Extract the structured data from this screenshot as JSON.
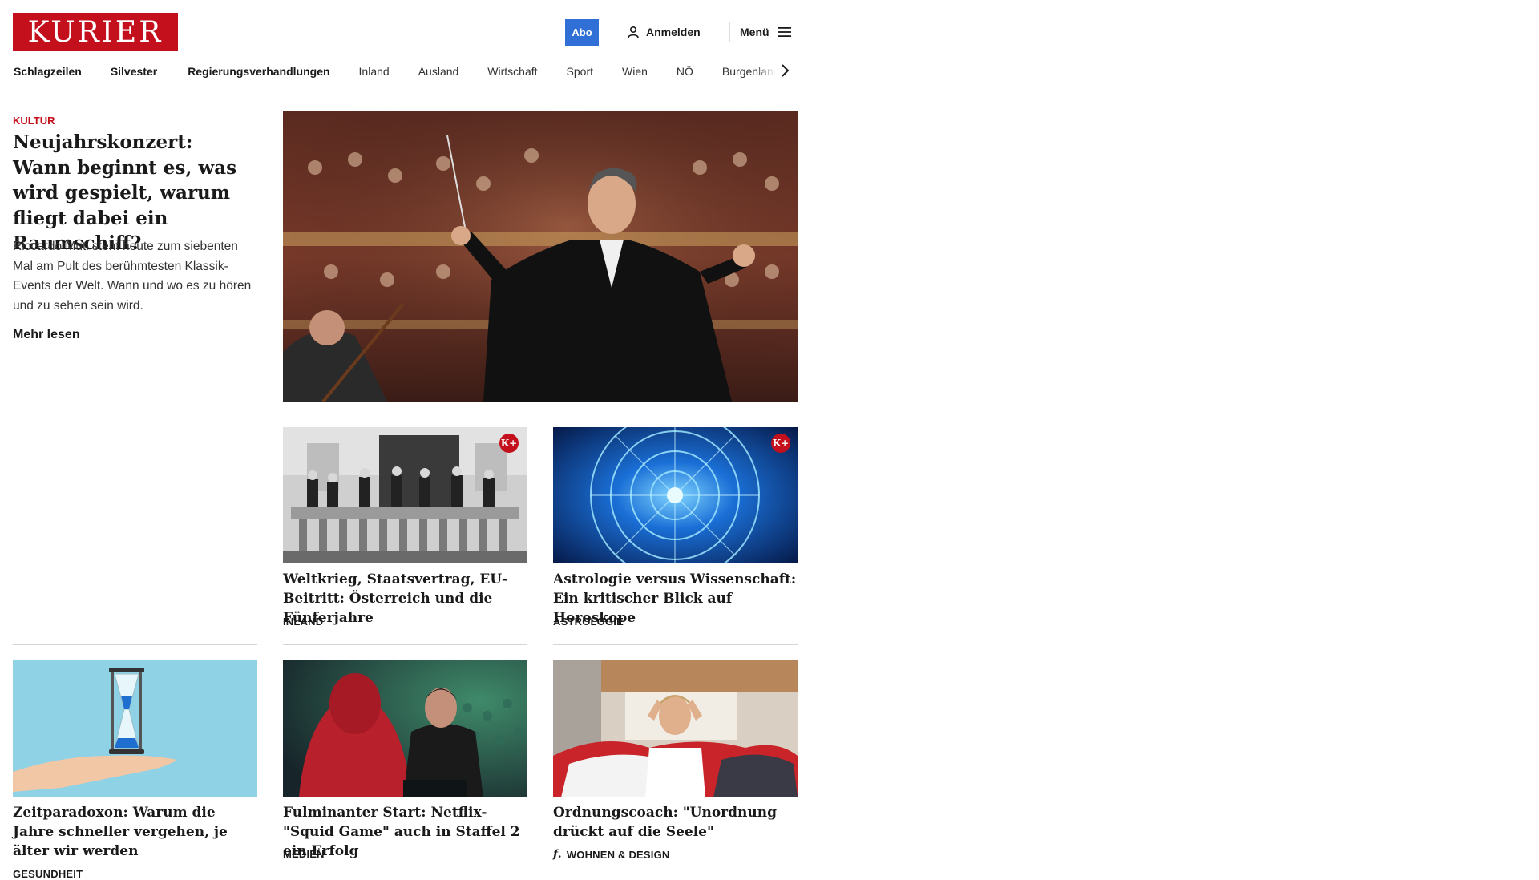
{
  "header": {
    "logo_text": "KURIER",
    "abo_label": "Abo",
    "login_label": "Anmelden",
    "menu_label": "Menü"
  },
  "nav": {
    "items": [
      {
        "label": "Schlagzeilen"
      },
      {
        "label": "Silvester"
      },
      {
        "label": "Regierungsverhandlungen"
      },
      {
        "label": "Inland"
      },
      {
        "label": "Ausland"
      },
      {
        "label": "Wirtschaft"
      },
      {
        "label": "Sport"
      },
      {
        "label": "Wien"
      },
      {
        "label": "NÖ"
      },
      {
        "label": "Burgenland"
      }
    ]
  },
  "lead": {
    "category": "KULTUR",
    "title": "Neujahrskonzert: Wann beginnt es, was wird ge­spielt, warum fliegt dabei ein Raumschiff?",
    "teaser": "Riccardo Muti steht heute zum siebenten Mal am Pult des berühmtesten Klassik-Events der Welt. Wann und wo es zu hören und zu sehen sein wird.",
    "more": "Mehr lesen"
  },
  "cards": [
    {
      "title": "Weltkrieg, Staatsvertrag, EU-Bei­tritt: Österreich und die Fünferjahre",
      "category": "INLAND",
      "premium_badge": "K+"
    },
    {
      "title": "Astrologie versus Wissenschaft: Ein kritischer Blick auf Horoskope",
      "category": "ASTROLOGIE",
      "premium_badge": "K+"
    },
    {
      "title": "Zeitparadoxon: Warum die Jahre schneller vergehen, je älter wir werden",
      "category": "GESUNDHEIT"
    },
    {
      "title": "Fulminanter Start: Netflix-\"Squid Game\" auch in Staffel 2 ein Erfolg",
      "category": "MEDIEN"
    },
    {
      "title": "Ordnungscoach: \"Unordnung drückt auf die Seele\"",
      "category": "WOHNEN & DESIGN",
      "category_icon": "f."
    }
  ],
  "colors": {
    "brand": "#c4101c",
    "abo": "#2f6fd6"
  }
}
